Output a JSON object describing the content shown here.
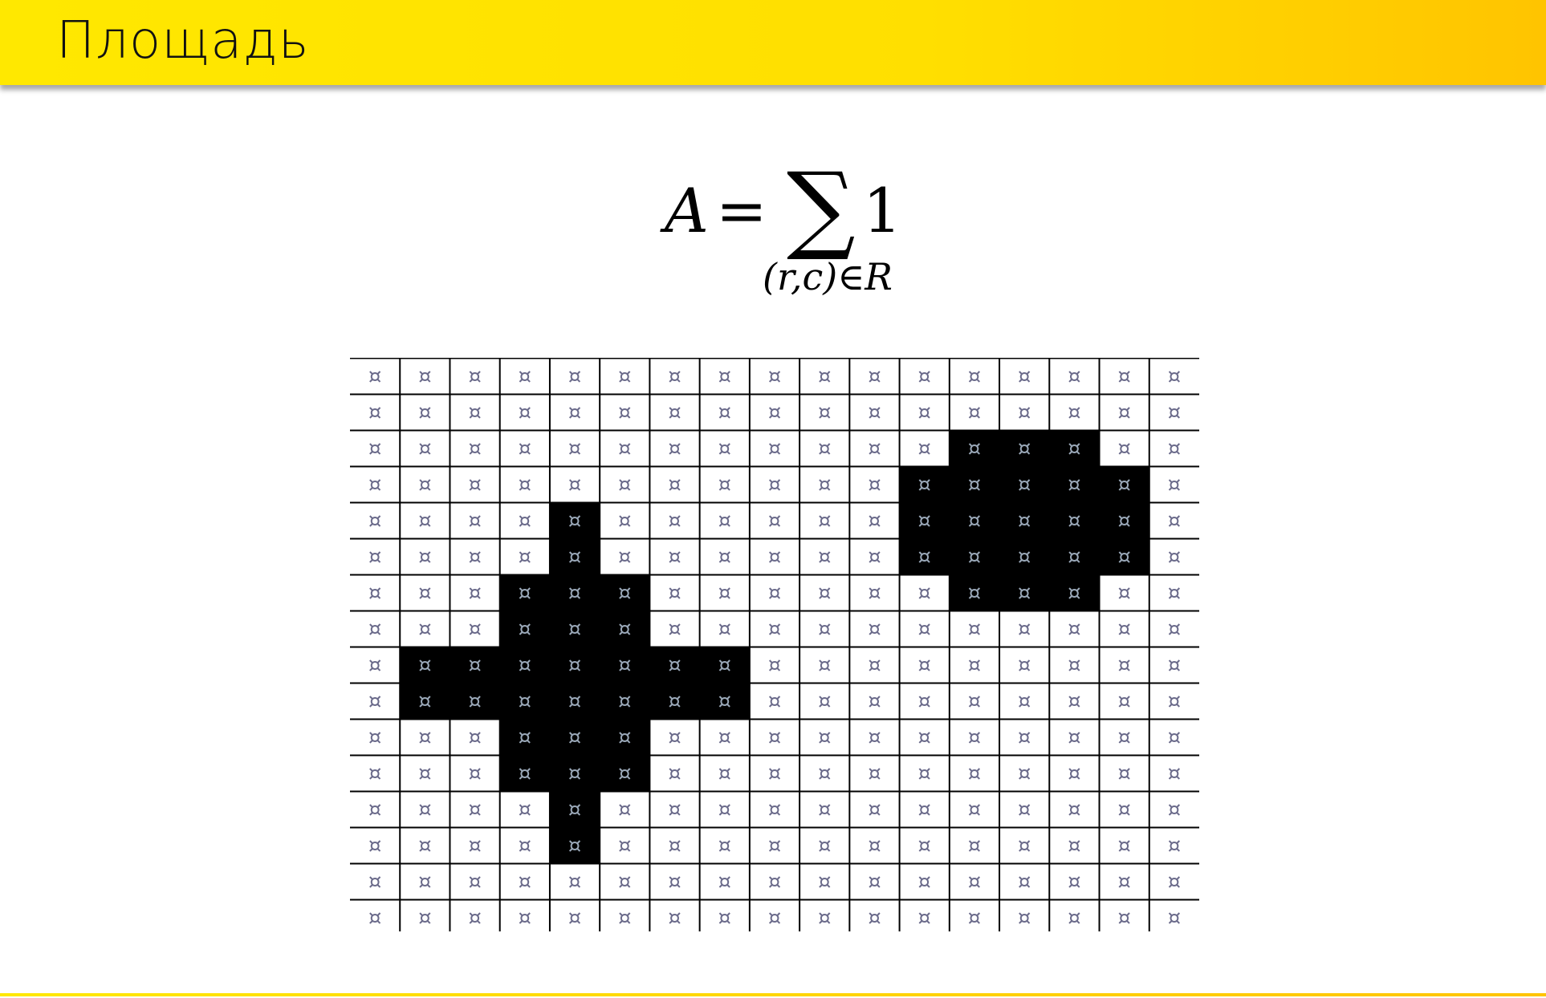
{
  "slide": {
    "title": "Площадь"
  },
  "formula": {
    "lhs": "A",
    "equals": "=",
    "sum_symbol": "∑",
    "summand": "1",
    "subscript": "(r,c)∈R"
  },
  "grid": {
    "rows": 16,
    "cols": 17,
    "cell_glyph": "¤",
    "filled_cells": [
      [
        2,
        12
      ],
      [
        2,
        13
      ],
      [
        2,
        14
      ],
      [
        3,
        11
      ],
      [
        3,
        12
      ],
      [
        3,
        13
      ],
      [
        3,
        14
      ],
      [
        3,
        15
      ],
      [
        4,
        4
      ],
      [
        4,
        11
      ],
      [
        4,
        12
      ],
      [
        4,
        13
      ],
      [
        4,
        14
      ],
      [
        4,
        15
      ],
      [
        5,
        4
      ],
      [
        5,
        11
      ],
      [
        5,
        12
      ],
      [
        5,
        13
      ],
      [
        5,
        14
      ],
      [
        5,
        15
      ],
      [
        6,
        3
      ],
      [
        6,
        4
      ],
      [
        6,
        5
      ],
      [
        6,
        12
      ],
      [
        6,
        13
      ],
      [
        6,
        14
      ],
      [
        7,
        3
      ],
      [
        7,
        4
      ],
      [
        7,
        5
      ],
      [
        8,
        1
      ],
      [
        8,
        2
      ],
      [
        8,
        3
      ],
      [
        8,
        4
      ],
      [
        8,
        5
      ],
      [
        8,
        6
      ],
      [
        8,
        7
      ],
      [
        9,
        1
      ],
      [
        9,
        2
      ],
      [
        9,
        3
      ],
      [
        9,
        4
      ],
      [
        9,
        5
      ],
      [
        9,
        6
      ],
      [
        9,
        7
      ],
      [
        10,
        3
      ],
      [
        10,
        4
      ],
      [
        10,
        5
      ],
      [
        11,
        3
      ],
      [
        11,
        4
      ],
      [
        11,
        5
      ],
      [
        12,
        4
      ],
      [
        13,
        4
      ]
    ],
    "colors": {
      "filled": "#000000",
      "empty": "#ffffff",
      "line": "#000000",
      "glyph_on_white": "#6a6a8a",
      "glyph_on_black": "#9aa8b8"
    }
  }
}
